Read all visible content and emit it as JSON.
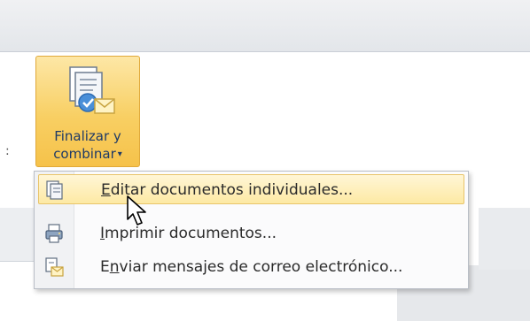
{
  "ribbon": {
    "finalize_button": {
      "line1": "Finalizar y",
      "line2": "combinar",
      "arrow": "▾",
      "icon": "merge-documents-icon"
    },
    "left_mark": ":"
  },
  "menu": {
    "items": [
      {
        "hotkey": "E",
        "rest": "ditar documentos individuales...",
        "icon": "edit-documents-icon",
        "highlighted": true
      },
      {
        "hotkey": "I",
        "rest": "mprimir documentos...",
        "icon": "print-documents-icon",
        "highlighted": false
      },
      {
        "prefix": "E",
        "hotkey": "n",
        "rest": "viar mensajes de correo electrónico...",
        "icon": "email-messages-icon",
        "highlighted": false
      }
    ]
  },
  "colors": {
    "button_highlight": "#f8cf63",
    "menu_hover": "#fde9a4",
    "label_text": "#1f3a66"
  }
}
